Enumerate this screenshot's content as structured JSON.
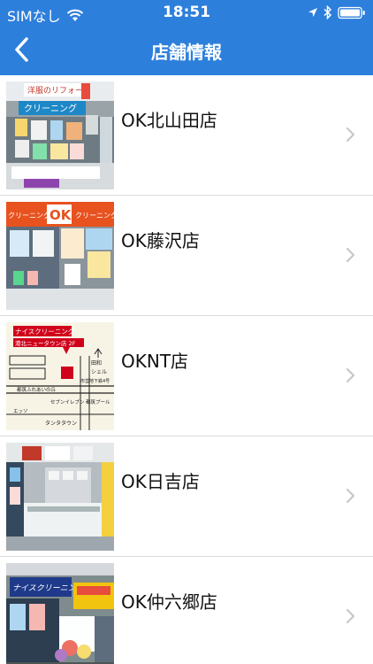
{
  "status_bar": {
    "carrier": "SIMなし",
    "time": "18:51"
  },
  "nav": {
    "title": "店舗情報",
    "back_icon": "chevron-left-icon"
  },
  "stores": [
    {
      "name": "OK北山田店",
      "thumb_text": [
        "洋服のリフォーム",
        "クリーニング"
      ]
    },
    {
      "name": "OK藤沢店",
      "thumb_text": [
        "クリーニング",
        "OK",
        "クリーニング"
      ]
    },
    {
      "name": "OKNT店",
      "thumb_text": [
        "ナイスクリーニング",
        "港北ニュータウン店 2F",
        "田和",
        "シェル",
        "市営地下鉄4号",
        "都筑ふれあいの丘",
        "セブンイレブン",
        "都筑プール",
        "エッソ",
        "タンタタウン"
      ]
    },
    {
      "name": "OK日吉店",
      "thumb_text": []
    },
    {
      "name": "OK仲六郷店",
      "thumb_text": [
        "ナイスクリーニング"
      ]
    }
  ],
  "colors": {
    "header_bg": "#2d7fdc",
    "divider": "#dcdcdc",
    "chevron": "#c7c7cc"
  }
}
